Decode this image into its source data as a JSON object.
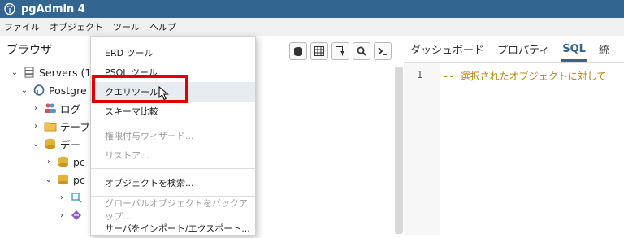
{
  "app": {
    "title": "pgAdmin 4"
  },
  "menubar": {
    "items": [
      "ファイル",
      "オブジェクト",
      "ツール",
      "ヘルプ"
    ]
  },
  "browser": {
    "title": "ブラウザ",
    "toolbar_icons": [
      "database-icon",
      "grid-icon",
      "filter-icon",
      "search-icon",
      "terminal-icon"
    ],
    "tree": {
      "servers": "Servers (1",
      "postgres": "Postgre",
      "login": "ログ",
      "tablespaces": "テーブ",
      "databases": "デー",
      "db1": "pc",
      "db2": "pc"
    }
  },
  "right_pane": {
    "tabs": [
      "ダッシュボード",
      "プロパティ",
      "SQL",
      "統"
    ],
    "active_tab": "SQL",
    "editor": {
      "line_number": "1",
      "code": "-- 選択されたオブジェクトに対して"
    }
  },
  "tools_menu": {
    "items": [
      {
        "label": "ERD ツール",
        "disabled": false
      },
      {
        "label": "PSQL ツール",
        "disabled": false
      },
      {
        "label": "クエリツール",
        "disabled": false,
        "hover": true
      },
      {
        "label": "スキーマ比較",
        "disabled": false
      },
      {
        "label": "権限付与ウィザード...",
        "disabled": true
      },
      {
        "label": "リストア...",
        "disabled": true
      },
      {
        "label": "オブジェクトを検索...",
        "disabled": false
      },
      {
        "label": "グローバルオブジェクトをバックアップ...",
        "disabled": true
      },
      {
        "label": "サーバをインポート/エクスポート...",
        "disabled": false
      }
    ]
  },
  "colors": {
    "accent": "#326690",
    "highlight": "#e00000"
  }
}
